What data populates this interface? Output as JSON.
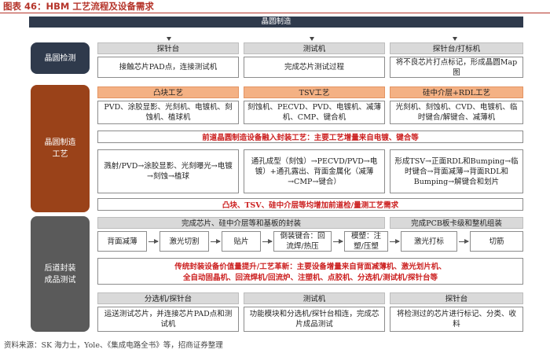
{
  "title": "图表 46：HBM 工艺流程及设备需求",
  "top_banner": "晶圆制造",
  "stages": {
    "inspection": "晶圆检测",
    "fab": "晶圆制造\n工艺",
    "backend": "后道封装\n成品测试"
  },
  "inspection": {
    "headers": [
      "探针台",
      "测试机",
      "探针台/打标机"
    ],
    "cells": [
      "接触芯片PAD点，连接测试机",
      "完成芯片测试过程",
      "将不良芯片打点标记，形成晶圆Map图"
    ]
  },
  "fab": {
    "headers": [
      "凸块工艺",
      "TSV工艺",
      "硅中介层+RDL工艺"
    ],
    "equipment": [
      "PVD、涂胶显影、光刻机、电镀机、刻蚀机、植球机",
      "刻蚀机、PECVD、PVD、电镀机、减薄机、CMP、键合机",
      "光刻机、刻蚀机、CVD、电镀机、临时键合/解键合、减薄机"
    ],
    "note1": "前道晶圆制造设备融入封装工艺：主要工艺增量来自电镀、键合等",
    "process": [
      "溅射/PVD→涂胶显影、光刻曝光→电镀→刻蚀→植球",
      "通孔成型（刻蚀）→PECVD/PVD→电镀）+通孔露出、背面金属化（减薄→CMP→键合）",
      "形成TSV→正面RDL和Bumping→临时键合→背面减薄→背面RDL和Bumping→解键合和划片"
    ],
    "note2": "凸块、TSV、硅中介层等均增加前道检/量测工艺需求"
  },
  "backend": {
    "headers": [
      "完成芯片、硅中介层等和基板的封装",
      "完成PCB板卡级和整机组装"
    ],
    "steps": [
      "背面减薄",
      "激光切割",
      "贴片",
      "倒装键合：回流焊/热压",
      "模塑：注塑/压塑",
      "激光打标",
      "切筋"
    ],
    "note": [
      "传统封装设备价值量提升/工艺革新：主要设备增量来自背面减薄机、激光划片机、",
      "全自动固晶机、回流焊机/回流炉、注塑机、点胶机、分选机/测试机/探针台等"
    ]
  },
  "test": {
    "headers": [
      "分选机/探针台",
      "测试机",
      "探针台"
    ],
    "cells": [
      "运送测试芯片，并连接芯片PAD点和测试机",
      "功能模块和分选机/探针台相连，完成芯片成品测试",
      "将检测过的芯片进行标记、分类、收料"
    ]
  },
  "footer": "资料来源：SK 海力士，Yole、《集成电路全书》等，招商证券整理",
  "colors": {
    "title": "#b5342a",
    "banner": "#2f3a4c",
    "inspection": "#2f3a4c",
    "fab": "#9a4219",
    "backend": "#5a5a5a",
    "header_orange": "#f4b184",
    "header_gray": "#d9d9d9",
    "note_red": "#cc2121"
  }
}
